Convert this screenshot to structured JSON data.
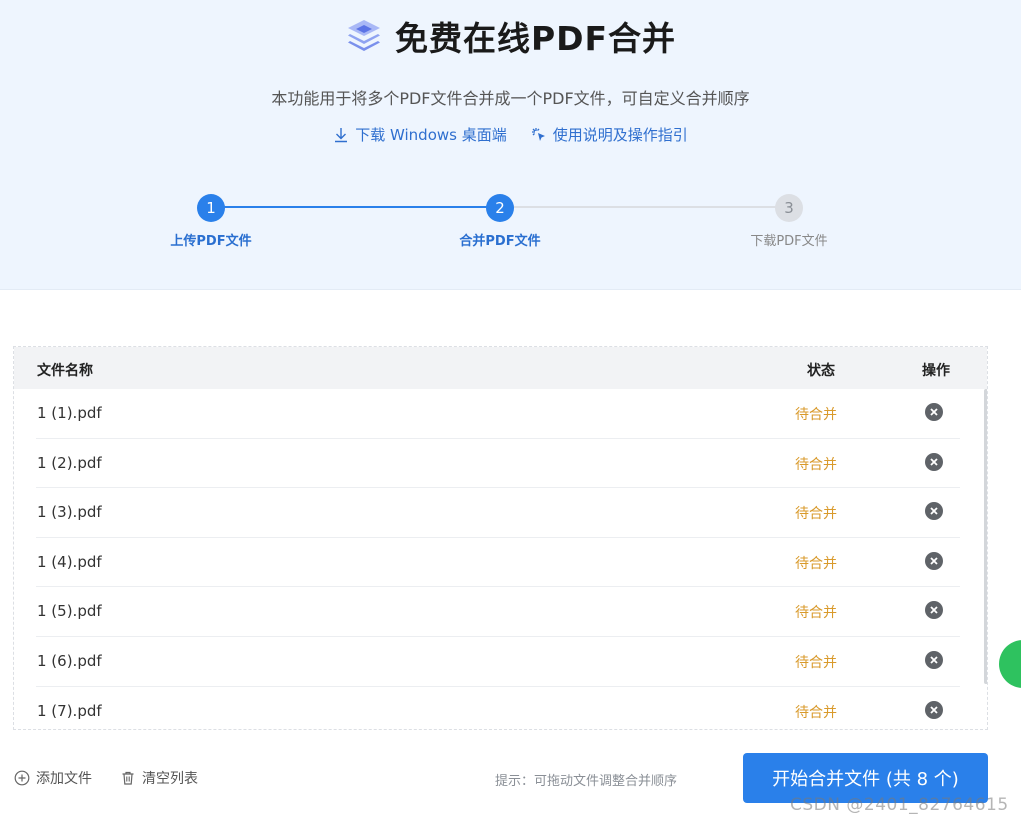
{
  "header": {
    "title": "免费在线PDF合并",
    "subtitle": "本功能用于将多个PDF文件合并成一个PDF文件，可自定义合并顺序",
    "links": [
      {
        "label": "下载 Windows 桌面端",
        "icon": "download-icon"
      },
      {
        "label": "使用说明及操作指引",
        "icon": "pointer-click-icon"
      }
    ]
  },
  "steps": [
    {
      "number": "1",
      "label": "上传PDF文件",
      "state": "active"
    },
    {
      "number": "2",
      "label": "合并PDF文件",
      "state": "active"
    },
    {
      "number": "3",
      "label": "下载PDF文件",
      "state": "pending"
    }
  ],
  "table": {
    "columns": [
      "文件名称",
      "状态",
      "操作"
    ],
    "rows": [
      {
        "name": "1 (1).pdf",
        "status": "待合并"
      },
      {
        "name": "1 (2).pdf",
        "status": "待合并"
      },
      {
        "name": "1 (3).pdf",
        "status": "待合并"
      },
      {
        "name": "1 (4).pdf",
        "status": "待合并"
      },
      {
        "name": "1 (5).pdf",
        "status": "待合并"
      },
      {
        "name": "1 (6).pdf",
        "status": "待合并"
      },
      {
        "name": "1 (7).pdf",
        "status": "待合并"
      }
    ]
  },
  "footer": {
    "add_label": "添加文件",
    "clear_label": "清空列表",
    "hint": "提示：可拖动文件调整合并顺序",
    "primary_label": "开始合并文件 (共 8 个)"
  },
  "watermark": "CSDN @2401_82764615",
  "colors": {
    "accent": "#2a80ea",
    "status_pending": "#d99a2b",
    "hero_bg": "#eef5fe"
  }
}
